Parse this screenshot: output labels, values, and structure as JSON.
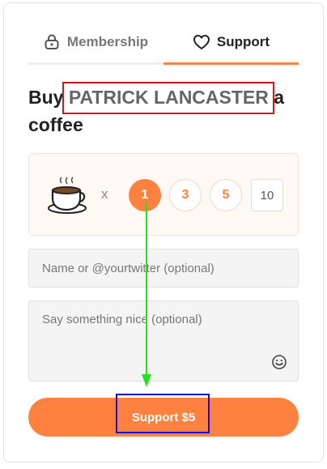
{
  "tabs": [
    {
      "label": "Membership",
      "icon": "lock-icon",
      "active": false
    },
    {
      "label": "Support",
      "icon": "heart-icon",
      "active": true
    }
  ],
  "heading": {
    "prefix": "Buy ",
    "creator": "PATRICK LANCASTER",
    "suffix": " a coffee"
  },
  "selector": {
    "icon": "coffee-cup-icon",
    "times": "x",
    "options": [
      "1",
      "3",
      "5"
    ],
    "selected": "1",
    "custom_value": "10"
  },
  "form": {
    "name_placeholder": "Name or @yourtwitter (optional)",
    "message_placeholder": "Say something nice (optional)",
    "emoji_icon": "smiley-icon"
  },
  "submit": {
    "label": "Support $5"
  },
  "colors": {
    "accent": "#ff813f",
    "annotation_red": "#d81414",
    "annotation_blue": "#1010d8",
    "annotation_green": "#22e022"
  }
}
